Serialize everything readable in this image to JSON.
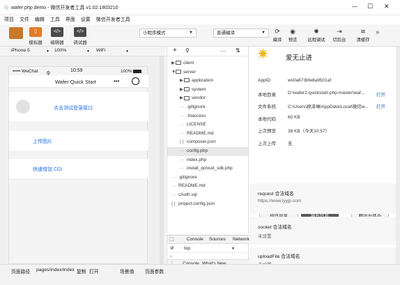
{
  "window": {
    "title": "wafer php demo - 微信开发者工具 v1.02.1803210",
    "minimize": "—",
    "maximize": "☐",
    "close": "✕"
  },
  "menu": [
    "项目",
    "文件",
    "编辑",
    "工具",
    "界面",
    "设置",
    "微信开发者工具"
  ],
  "toolbar": {
    "simulator": "模拟器",
    "editor": "编辑器",
    "debugger": "调试器",
    "mode_select": "小程序模式",
    "compile_select": "普通编译",
    "compile": "编译",
    "preview": "预览",
    "remote_debug": "远程调试",
    "background": "切后台",
    "clear_cache": "清缓存",
    "more": "»"
  },
  "devbar": {
    "device": "iPhone 5",
    "zoom": "100%",
    "network": "WiFi"
  },
  "phone": {
    "carrier": "••••• WeChat",
    "wifi": "令",
    "time": "10:59",
    "battery": "100%",
    "nav_title": "Wafer Quick Start",
    "nav_dots": "•••",
    "login_link": "点击测试登录接口",
    "upload": "上传图片",
    "cgi": "快速增加 CGI"
  },
  "filetree": {
    "add": "+",
    "search": "⚲",
    "dots": "···",
    "sort": "⇅",
    "items": [
      {
        "label": "client",
        "type": "folder",
        "indent": 0,
        "caret": "▶"
      },
      {
        "label": "server",
        "type": "folder",
        "indent": 0,
        "caret": "▼"
      },
      {
        "label": "application",
        "type": "folder",
        "indent": 1,
        "caret": "▶"
      },
      {
        "label": "system",
        "type": "folder",
        "indent": 1,
        "caret": "▶"
      },
      {
        "label": "vendor",
        "type": "folder",
        "indent": 1,
        "caret": "▶"
      },
      {
        "label": ".gitignore",
        "type": "file",
        "indent": 1,
        "icon": "···"
      },
      {
        "label": ".htaccess",
        "type": "file",
        "indent": 1,
        "icon": "···"
      },
      {
        "label": "LICENSE",
        "type": "file",
        "indent": 1,
        "icon": "···"
      },
      {
        "label": "README.md",
        "type": "file",
        "indent": 1,
        "icon": "···"
      },
      {
        "label": "composer.json",
        "type": "file",
        "indent": 1,
        "icon": "{ }"
      },
      {
        "label": "config.php",
        "type": "file",
        "indent": 1,
        "icon": "···"
      },
      {
        "label": "index.php",
        "type": "file",
        "indent": 1,
        "icon": "···"
      },
      {
        "label": "install_qcloud_sdk.php",
        "type": "file",
        "indent": 1,
        "icon": "···"
      },
      {
        "label": ".gitignore",
        "type": "file",
        "indent": 0,
        "icon": "···"
      },
      {
        "label": "README.md",
        "type": "file",
        "indent": 0,
        "icon": "···"
      },
      {
        "label": "cAuth.sql",
        "type": "file",
        "indent": 0,
        "icon": "···"
      },
      {
        "label": "project.config.json",
        "type": "file",
        "indent": 0,
        "icon": "{ }"
      }
    ]
  },
  "console": {
    "tab_console": "Console",
    "tab_sources": "Sources",
    "tab_network": "Network",
    "filter": "top",
    "bottom_tab1": "Console",
    "bottom_tab2": "What's New"
  },
  "detail": {
    "app_name": "爱无止进",
    "rows": [
      {
        "key": "AppID",
        "value": "wx0a673bfe8a9501af",
        "action": ""
      },
      {
        "key": "本地目录",
        "value": "D:\\wafer2-quickstart-php-master\\waf...",
        "action": "打开"
      },
      {
        "key": "文件系统",
        "value": "C:\\Users\\顾泽琳\\AppData\\Local\\微信w...",
        "action": "打开"
      },
      {
        "key": "本地代码",
        "value": "60 KB",
        "action": ""
      },
      {
        "key": "上次预览",
        "value": "38 KB（今天10:57）",
        "action": ""
      },
      {
        "key": "上次上传",
        "value": "无",
        "action": ""
      }
    ],
    "tabs": [
      "项目设置",
      "域名信息",
      "腾讯云状态"
    ],
    "sections": [
      {
        "title": "request 合法域名",
        "value": "https://www.lyyjp.com"
      },
      {
        "title": "socket 合法域名",
        "value": "未设置"
      },
      {
        "title": "uploadFile 合法域名",
        "value": "未设置"
      }
    ]
  },
  "footer": {
    "path_label": "页面路径",
    "path": "pages/index/index",
    "copy": "复制",
    "open": "打开",
    "scene_label": "场景值",
    "params_label": "页面参数"
  }
}
